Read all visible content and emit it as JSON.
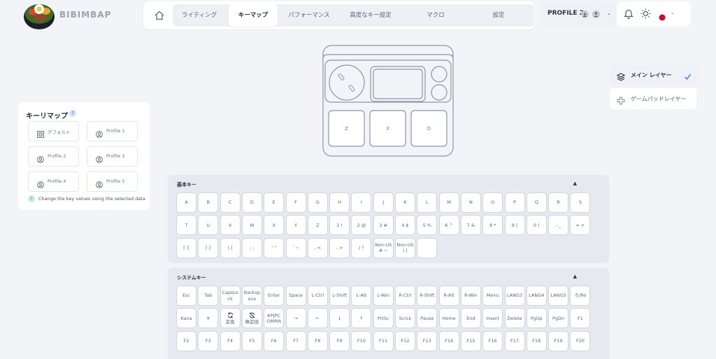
{
  "app": {
    "brand": "BIBIMBAP"
  },
  "nav": {
    "tabs": [
      {
        "label": "ライティング"
      },
      {
        "label": "キーマップ"
      },
      {
        "label": "パフォーマンス"
      },
      {
        "label": "高度なキー設定"
      },
      {
        "label": "マクロ"
      },
      {
        "label": "設定"
      }
    ],
    "active_tab": 1
  },
  "profile": {
    "label": "PROFILE 2"
  },
  "keymap_panel": {
    "title": "キーリマップ",
    "help": "?",
    "presets": [
      {
        "label": "デフォルト",
        "icon": "grid-icon"
      },
      {
        "label": "Profile 1",
        "icon": "user-icon"
      },
      {
        "label": "Profile 2",
        "icon": "user-icon"
      },
      {
        "label": "Profile 3",
        "icon": "user-icon"
      },
      {
        "label": "Profile 4",
        "icon": "user-icon"
      },
      {
        "label": "Profile 5",
        "icon": "user-icon"
      }
    ],
    "hint": "Change the key values using the selected data",
    "hint_icon": "!"
  },
  "device": {
    "keys": [
      "Z",
      "X",
      "D"
    ]
  },
  "layers": [
    {
      "label": "メイン レイヤー",
      "icon": "layers-icon",
      "active": true
    },
    {
      "label": "ゲームパッドレイヤー",
      "icon": "gamepad-icon",
      "active": false
    }
  ],
  "basic_keys": {
    "title": "基本キー",
    "caret": "▲",
    "rows": [
      [
        "A",
        "B",
        "C",
        "D",
        "E",
        "F",
        "G",
        "H",
        "I",
        "J",
        "K",
        "L",
        "M",
        "N",
        "O",
        "P",
        "Q",
        "R",
        "S"
      ],
      [
        "T",
        "U",
        "V",
        "W",
        "X",
        "Y",
        "Z",
        "1 !",
        "2 @",
        "3 #",
        "4 $",
        "5 %",
        "6 ^",
        "7 &",
        "8 *",
        "9 (",
        "0 )",
        "- _",
        "= +"
      ],
      [
        "[ {",
        "] }",
        "\\ |",
        "; :",
        "' \"",
        "` ~",
        ", <",
        ". >",
        "/ ?",
        "Non-US\n# ~",
        "Non-US\n\\ |",
        ""
      ]
    ]
  },
  "system_keys": {
    "title": "システムキー",
    "caret": "▲",
    "rows": [
      [
        "Esc",
        "Tab",
        "CapsLo\nck",
        "Backsp\nace",
        "Enter",
        "Space",
        "L-Ctrl",
        "L-Shift",
        "L-Alt",
        "L-Win",
        "R-Ctrl",
        "R-Shift",
        "R-Alt",
        "R-Win",
        "Menu",
        "LANG3",
        "LANG4",
        "LANG5",
        "ろ/Ro"
      ],
      [
        "Kana",
        "¥",
        "変換",
        "無変換",
        "KPJPC\nOMMA",
        "→",
        "←",
        "↓",
        "↑",
        "PrtSc",
        "ScrLk",
        "Pause",
        "Home",
        "End",
        "Insert",
        "Delete",
        "PgUp",
        "PgDn",
        "F1"
      ],
      [
        "F2",
        "F3",
        "F4",
        "F5",
        "F6",
        "F7",
        "F8",
        "F9",
        "F10",
        "F11",
        "F12",
        "F13",
        "F14",
        "F15",
        "F16",
        "F17",
        "F18",
        "F19",
        "F20"
      ]
    ]
  },
  "colors": {
    "accent": "#3b82f6",
    "flag": "#c8102e",
    "section_bg": "#e6eaf0",
    "page_bg": "#f2f4f7"
  }
}
